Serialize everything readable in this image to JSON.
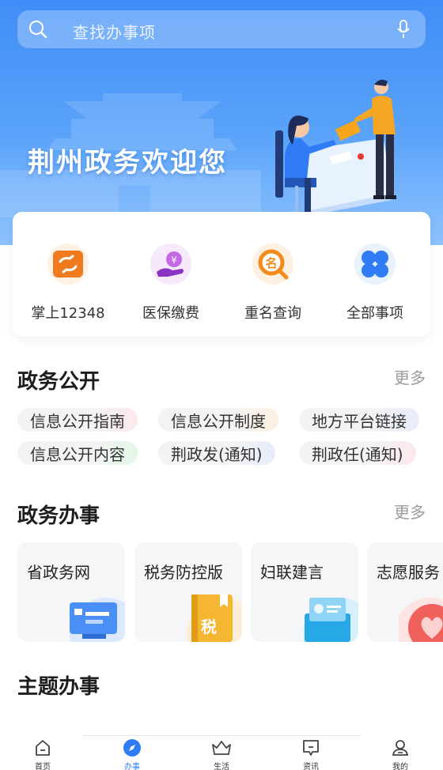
{
  "search": {
    "placeholder": "查找办事项"
  },
  "hero": {
    "title": "荆州政务欢迎您"
  },
  "quick_actions": [
    {
      "label": "掌上12348",
      "icon": "swap-card-icon",
      "color": "#f07b1f"
    },
    {
      "label": "医保缴费",
      "icon": "yen-hand-icon",
      "color": "#a64bd6"
    },
    {
      "label": "重名查询",
      "icon": "name-search-icon",
      "color": "#f28a1c"
    },
    {
      "label": "全部事项",
      "icon": "grid-icon",
      "color": "#2f7cf6"
    }
  ],
  "gov_open": {
    "title": "政务公开",
    "more": "更多",
    "tags": [
      "信息公开指南",
      "信息公开制度",
      "地方平台链接",
      "信息公开内容",
      "荆政发(通知)",
      "荆政任(通知)"
    ]
  },
  "gov_service": {
    "title": "政务办事",
    "more": "更多",
    "items": [
      "省政务网",
      "税务防控版",
      "妇联建言",
      "志愿服务"
    ]
  },
  "theme_service": {
    "title": "主题办事"
  },
  "tabbar": {
    "tabs": [
      {
        "label": "首页",
        "icon": "home-icon"
      },
      {
        "label": "办事",
        "icon": "compass-icon",
        "active": true
      },
      {
        "label": "生活",
        "icon": "basket-icon"
      },
      {
        "label": "资讯",
        "icon": "message-icon"
      },
      {
        "label": "我的",
        "icon": "user-icon"
      }
    ],
    "active_color": "#2f7cf6"
  }
}
